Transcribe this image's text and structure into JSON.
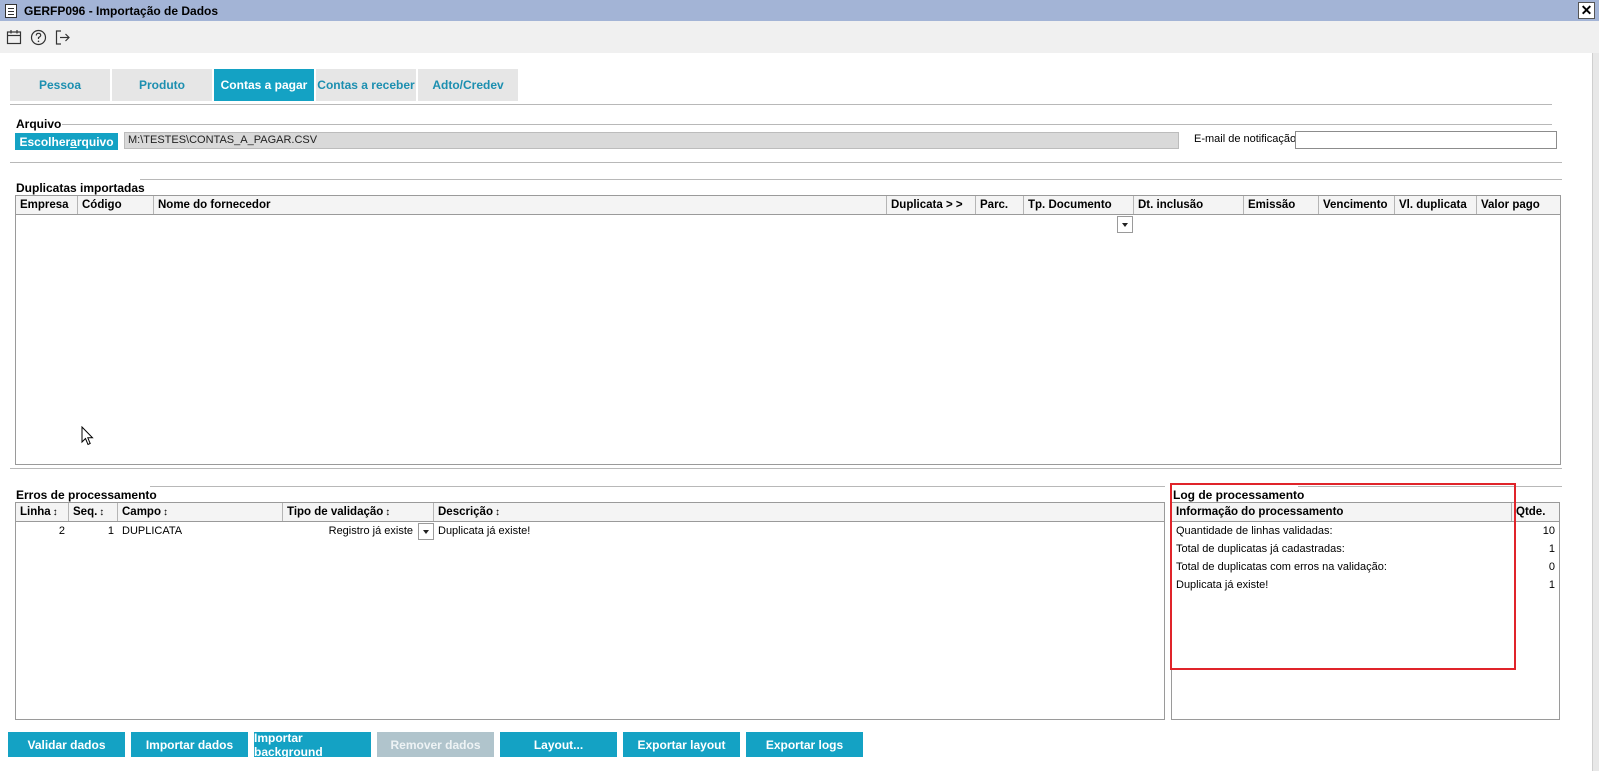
{
  "window": {
    "title": "GERFP096 - Importação de Dados",
    "close_glyph": "✕"
  },
  "toolbar": {
    "icons": [
      "calendar-icon",
      "help-icon",
      "exit-icon"
    ]
  },
  "tabs": [
    {
      "label": "Pessoa",
      "active": false
    },
    {
      "label": "Produto",
      "active": false
    },
    {
      "label": "Contas a pagar",
      "active": true
    },
    {
      "label": "Contas a receber",
      "active": false
    },
    {
      "label": "Adto/Credev",
      "active": false
    }
  ],
  "arquivo": {
    "section_label": "Arquivo",
    "choose_button_prefix": "Escolher ",
    "choose_button_accel": "a",
    "choose_button_suffix": "rquivo",
    "file_path": "M:\\TESTES\\CONTAS_A_PAGAR.CSV",
    "email_label": "E-mail de notificação",
    "email_value": ""
  },
  "duplicatas": {
    "section_label": "Duplicatas importadas",
    "columns": [
      "Empresa",
      "Código",
      "Nome do fornecedor",
      "Duplicata > >",
      "Parc.",
      "Tp. Documento",
      "Dt. inclusão",
      "Emissão",
      "Vencimento",
      "Vl. duplicata",
      "Valor pago"
    ],
    "rows": []
  },
  "erros": {
    "section_label": "Erros de processamento",
    "columns": [
      "Linha",
      "Seq.",
      "Campo",
      "Tipo de validação",
      "Descrição"
    ],
    "sort_glyph": "↕",
    "rows": [
      {
        "linha": "2",
        "seq": "1",
        "campo": "DUPLICATA",
        "tipo": "Registro já existe",
        "descricao": "Duplicata já existe!"
      }
    ]
  },
  "log": {
    "section_label": "Log de processamento",
    "columns": [
      "Informação do processamento",
      "Qtde."
    ],
    "rows": [
      {
        "info": "Quantidade de linhas validadas:",
        "qtde": "10"
      },
      {
        "info": "Total de duplicatas já cadastradas:",
        "qtde": "1"
      },
      {
        "info": "Total de duplicatas com erros na validação:",
        "qtde": "0"
      },
      {
        "info": "Duplicata já existe!",
        "qtde": "1"
      }
    ]
  },
  "buttons": [
    {
      "label": "Validar dados",
      "enabled": true
    },
    {
      "label": "Importar dados",
      "enabled": true
    },
    {
      "label": "Importar background",
      "enabled": true
    },
    {
      "label": "Remover dados",
      "enabled": false
    },
    {
      "label": "Layout...",
      "enabled": true
    },
    {
      "label": "Exportar layout",
      "enabled": true
    },
    {
      "label": "Exportar logs",
      "enabled": true
    }
  ],
  "colors": {
    "accent": "#14a2c4",
    "titlebar": "#a3b4d6",
    "highlight": "#e0242a"
  }
}
